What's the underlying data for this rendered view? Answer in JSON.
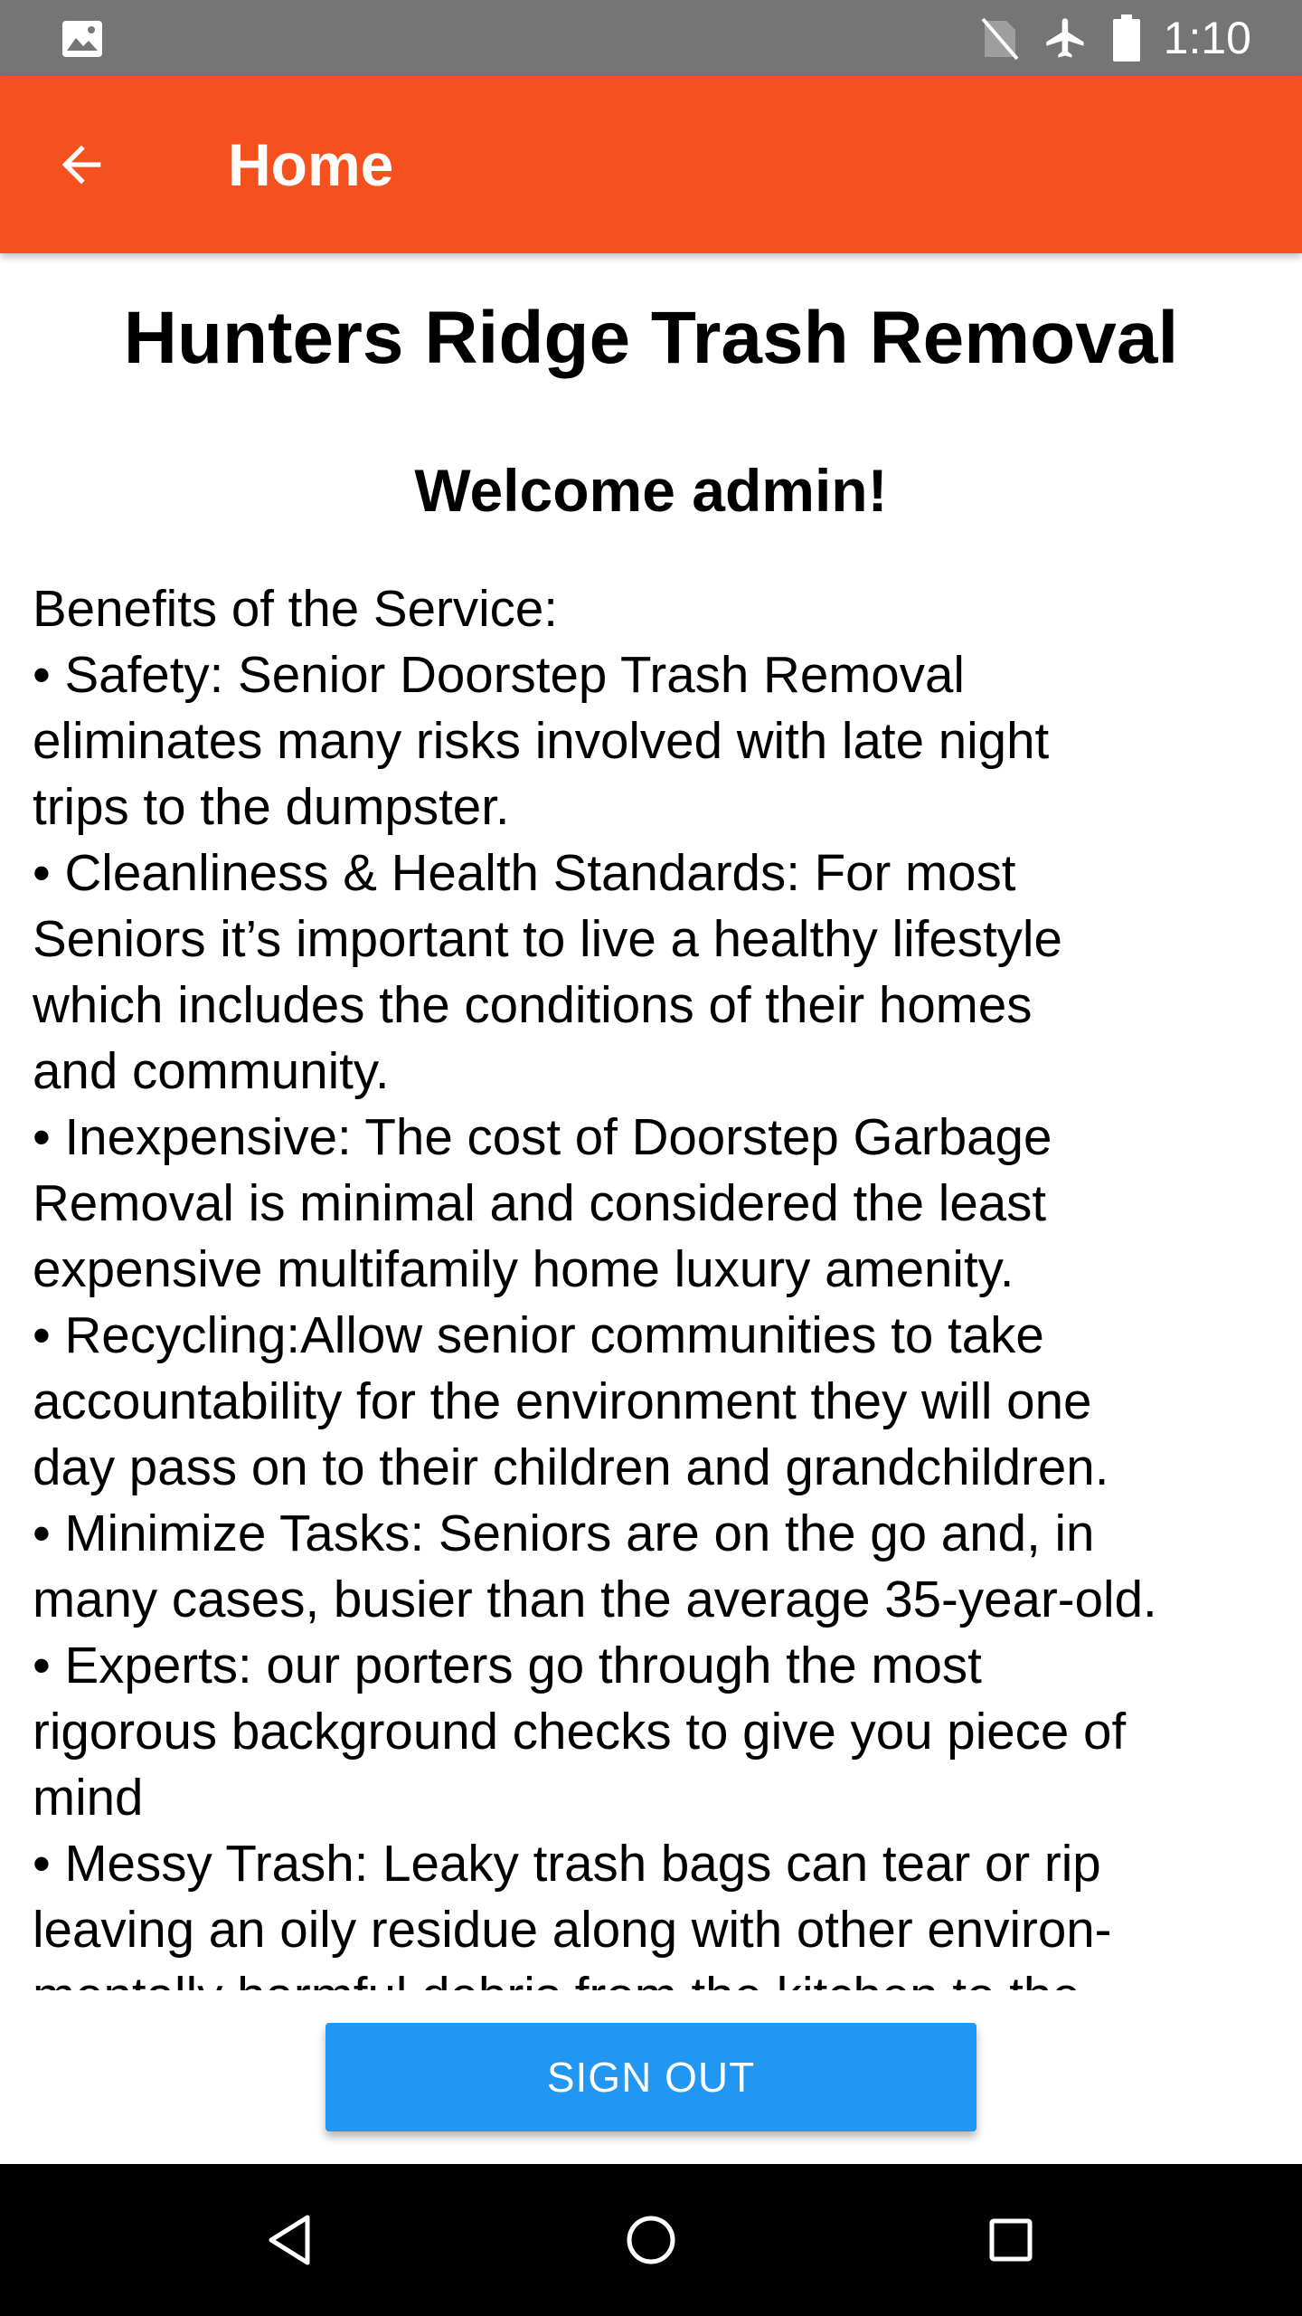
{
  "status_bar": {
    "time": "1:10",
    "icons": [
      "gallery-icon",
      "no-sim-icon",
      "airplane-mode-icon",
      "battery-icon"
    ]
  },
  "app_bar": {
    "back_icon": "arrow-back-icon",
    "title": "Home",
    "color": "#f4511e"
  },
  "main": {
    "heading": "Hunters Ridge Trash Removal",
    "welcome": "Welcome admin!",
    "benefits_lines": [
      "Benefits of the Service:",
      "• Safety: Senior Doorstep Trash Removal",
      "eliminates many risks involved with late night",
      "trips to the dumpster.",
      "• Cleanliness & Health Standards: For most",
      "Seniors it’s important to live a healthy lifestyle",
      "which includes the conditions of their homes",
      "and community.",
      "• Inexpensive: The cost of Doorstep Garbage",
      "Removal is minimal and considered the least",
      "expensive multifamily home luxury amenity.",
      "• Recycling:Allow senior communities to take",
      "accountability for the environment they will one",
      "day pass on to their children and grandchildren.",
      "• Minimize Tasks: Seniors are on the go and, in",
      "many cases, busier than the average 35-year-old.",
      "• Experts: our porters go through the most",
      "rigorous background checks to give you piece of",
      "mind",
      "• Messy Trash: Leaky trash bags can tear or rip",
      "leaving an oily residue along with other environ-",
      "mentally harmful debris from the kitchen to the"
    ]
  },
  "actions": {
    "sign_out_label": "SIGN OUT",
    "sign_out_color": "#2196f3"
  },
  "nav_bar": {
    "icons": [
      "back-triangle-icon",
      "home-circle-icon",
      "recents-square-icon"
    ]
  }
}
